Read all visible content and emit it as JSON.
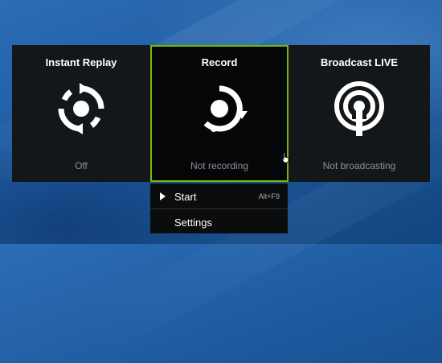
{
  "overlay": {
    "panels": [
      {
        "title": "Instant Replay",
        "status": "Off",
        "icon": "instant-replay-icon"
      },
      {
        "title": "Record",
        "status": "Not recording",
        "icon": "record-icon",
        "selected": true
      },
      {
        "title": "Broadcast LIVE",
        "status": "Not broadcasting",
        "icon": "broadcast-icon"
      }
    ],
    "accent_color": "#76b900"
  },
  "record_menu": {
    "items": [
      {
        "label": "Start",
        "shortcut": "Alt+F9",
        "icon": "play-icon"
      },
      {
        "label": "Settings"
      }
    ]
  },
  "colors": {
    "panel_bg": "#14171a",
    "selected_panel_bg": "#050607",
    "status_text": "#8d9196",
    "desktop": "#1d5aa0"
  }
}
